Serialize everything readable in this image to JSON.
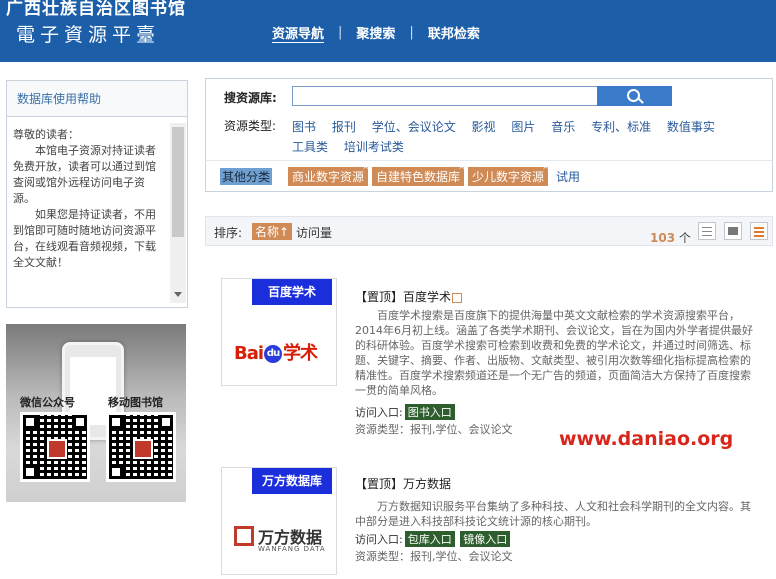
{
  "header": {
    "title": "广西壮族自治区图书馆",
    "subtitle": "電子資源平臺",
    "nav": [
      {
        "label": "资源导航"
      },
      {
        "label": "聚搜索"
      },
      {
        "label": "联邦检索"
      }
    ],
    "colors": {
      "bar": "#1c5fa8"
    }
  },
  "help": {
    "title": "数据库使用帮助",
    "greeting": "尊敬的读者：",
    "para1": "本馆电子资源对持证读者免费开放，读者可以通过到馆查阅或馆外远程访问电子资源。",
    "para2": "如果您是持证读者，不用到馆即可随时随地访问资源平台，在线观看音频视频，下载全文文献！"
  },
  "promo": {
    "wechat_label": "微信公众号",
    "mobile_label": "移动图书馆"
  },
  "search": {
    "label": "搜资源库:",
    "value": "",
    "button_icon": "search-icon",
    "type_label": "资源类型:",
    "types": [
      "图书",
      "报刊",
      "学位、会议论文",
      "影视",
      "图片",
      "音乐",
      "专利、标准",
      "数值事实",
      "工具类",
      "培训考试类"
    ],
    "other_label": "其他分类",
    "other_categories": [
      "商业数字资源",
      "自建特色数据库",
      "少儿数字资源"
    ],
    "other_plain": "试用"
  },
  "sort": {
    "label": "排序:",
    "by_name": "名称↑",
    "by_visits": "访问量",
    "count": "103",
    "count_unit": "个",
    "accent": "#d08a55"
  },
  "results": [
    {
      "banner": "百度学术",
      "logo_left": "Bai",
      "logo_paw": "du",
      "logo_right": "学术",
      "title": "【置顶】百度学术",
      "desc": "百度学术搜索是百度旗下的提供海量中英文文献检索的学术资源搜索平台，2014年6月初上线。涵盖了各类学术期刊、会议论文，旨在为国内外学者提供最好的科研体验。百度学术搜索可检索到收费和免费的学术论文，并通过时间筛选、标题、关键字、摘要、作者、出版物、文献类型、被引用次数等细化指标提高检索的精准性。百度学术搜索频道还是一个无广告的频道，页面简洁大方保持了百度搜索一贯的简单风格。",
      "access_label": "访问入口:",
      "links": [
        "图书入口"
      ],
      "type_text": "资源类型：报刊,学位、会议论文"
    },
    {
      "banner": "万方数据库",
      "logo_cn": "万方数据",
      "logo_en": "WANFANG DATA",
      "title": "【置顶】万方数据",
      "desc": "万方数据知识服务平台集纳了多种科技、人文和社会科学期刊的全文内容。其中部分是进入科技部科技论文统计源的核心期刊。",
      "access_label": "访问入口:",
      "links": [
        "包库入口",
        "镜像入口"
      ],
      "type_text": "资源类型：报刊,学位、会议论文"
    }
  ],
  "watermark": "www.daniao.org"
}
